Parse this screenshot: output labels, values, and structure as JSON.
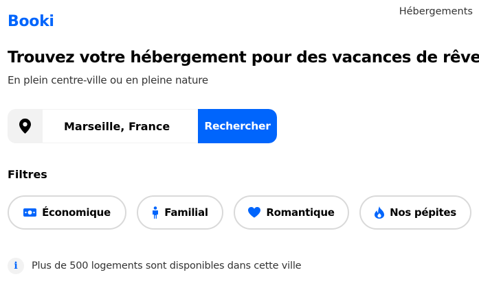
{
  "brand": {
    "name": "Booki",
    "color": "#0065FC"
  },
  "nav": {
    "link": "Hébergements"
  },
  "hero": {
    "title": "Trouvez votre hébergement pour des vacances de rêve",
    "subtitle": "En plein centre-ville ou en pleine nature"
  },
  "search": {
    "icon": "location-pin-icon",
    "value": "Marseille, France",
    "button": "Rechercher"
  },
  "filters": {
    "title": "Filtres",
    "items": [
      {
        "label": "Économique",
        "icon": "money-icon"
      },
      {
        "label": "Familial",
        "icon": "child-icon"
      },
      {
        "label": "Romantique",
        "icon": "heart-icon"
      },
      {
        "label": "Nos pépites",
        "icon": "fire-icon"
      }
    ]
  },
  "info": {
    "icon": "info-icon",
    "text": "Plus de 500 logements sont disponibles dans cette ville"
  }
}
